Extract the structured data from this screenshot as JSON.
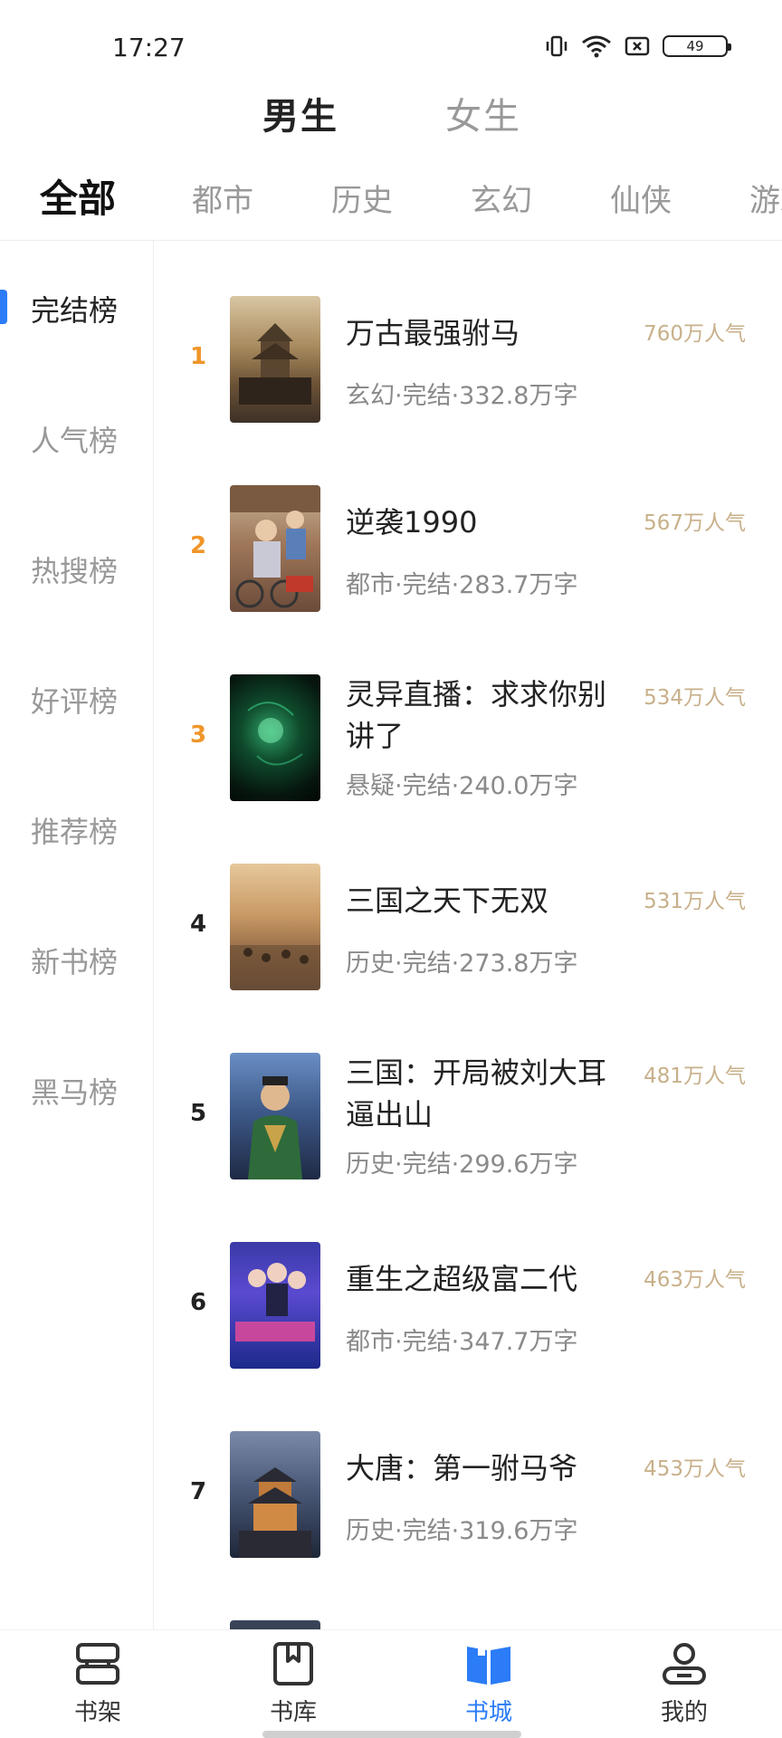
{
  "status_bar": {
    "time": "17:27",
    "battery": "49"
  },
  "gender_tabs": {
    "male": "男生",
    "female": "女生"
  },
  "category_tabs": [
    "全部",
    "都市",
    "历史",
    "玄幻",
    "仙侠",
    "游戏"
  ],
  "sidebar": {
    "items": [
      "完结榜",
      "人气榜",
      "热搜榜",
      "好评榜",
      "推荐榜",
      "新书榜",
      "黑马榜"
    ]
  },
  "books": [
    {
      "rank": "1",
      "title": "万古最强驸马",
      "meta": "玄幻·完结·332.8万字",
      "popularity": "760万人气"
    },
    {
      "rank": "2",
      "title": "逆袭1990",
      "meta": "都市·完结·283.7万字",
      "popularity": "567万人气"
    },
    {
      "rank": "3",
      "title": "灵异直播：求求你别讲了",
      "meta": "悬疑·完结·240.0万字",
      "popularity": "534万人气"
    },
    {
      "rank": "4",
      "title": "三国之天下无双",
      "meta": "历史·完结·273.8万字",
      "popularity": "531万人气"
    },
    {
      "rank": "5",
      "title": "三国：开局被刘大耳逼出山",
      "meta": "历史·完结·299.6万字",
      "popularity": "481万人气"
    },
    {
      "rank": "6",
      "title": "重生之超级富二代",
      "meta": "都市·完结·347.7万字",
      "popularity": "463万人气"
    },
    {
      "rank": "7",
      "title": "大唐：第一驸马爷",
      "meta": "历史·完结·319.6万字",
      "popularity": "453万人气"
    }
  ],
  "bottom_nav": {
    "items": [
      {
        "label": "书架",
        "icon": "bookshelf-icon"
      },
      {
        "label": "书库",
        "icon": "library-icon"
      },
      {
        "label": "书城",
        "icon": "bookstore-icon"
      },
      {
        "label": "我的",
        "icon": "profile-icon"
      }
    ]
  },
  "colors": {
    "accent": "#2b7cf6",
    "rank_top": "#f0962a",
    "popularity": "#c8b08a"
  }
}
